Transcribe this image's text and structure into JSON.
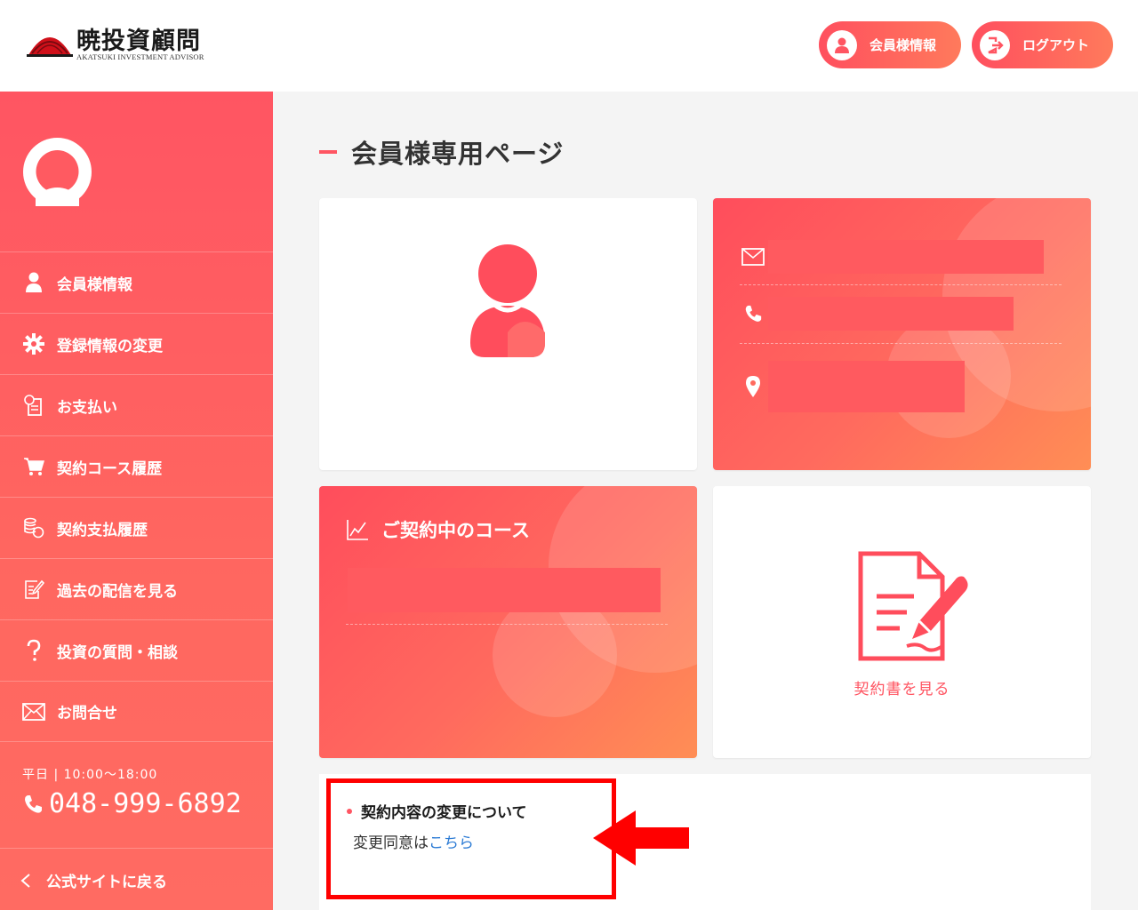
{
  "header": {
    "logo_text": "暁投資顧問",
    "logo_subtitle": "AKATSUKI INVESTMENT ADVISOR",
    "member_button_label": "会員様情報",
    "logout_button_label": "ログアウト"
  },
  "sidebar": {
    "items": [
      {
        "label": "会員様情報",
        "icon": "user-icon"
      },
      {
        "label": "登録情報の変更",
        "icon": "gear-icon"
      },
      {
        "label": "お支払い",
        "icon": "payment-doc-icon"
      },
      {
        "label": "契約コース履歴",
        "icon": "cart-icon"
      },
      {
        "label": "契約支払履歴",
        "icon": "coins-icon"
      },
      {
        "label": "過去の配信を見る",
        "icon": "edit-document-icon"
      },
      {
        "label": "投資の質問・相談",
        "icon": "question-icon"
      },
      {
        "label": "お問合せ",
        "icon": "mail-icon"
      }
    ],
    "hours": "平日 | 10:00〜18:00",
    "phone": "048-999-6892",
    "back_label": "公式サイトに戻る"
  },
  "main": {
    "page_title": "会員様専用ページ",
    "course_card_title": "ご契約中のコース",
    "contract_card_label": "契約書を見る",
    "notice": {
      "title": "契約内容の変更について",
      "body_prefix": "変更同意は",
      "link_label": "こちら"
    }
  },
  "colors": {
    "accent": "#ff5562",
    "gradient_start": "#ff4d5c",
    "gradient_end": "#ff8e55",
    "link": "#2a7ad4",
    "highlight_frame": "#ff0000"
  }
}
